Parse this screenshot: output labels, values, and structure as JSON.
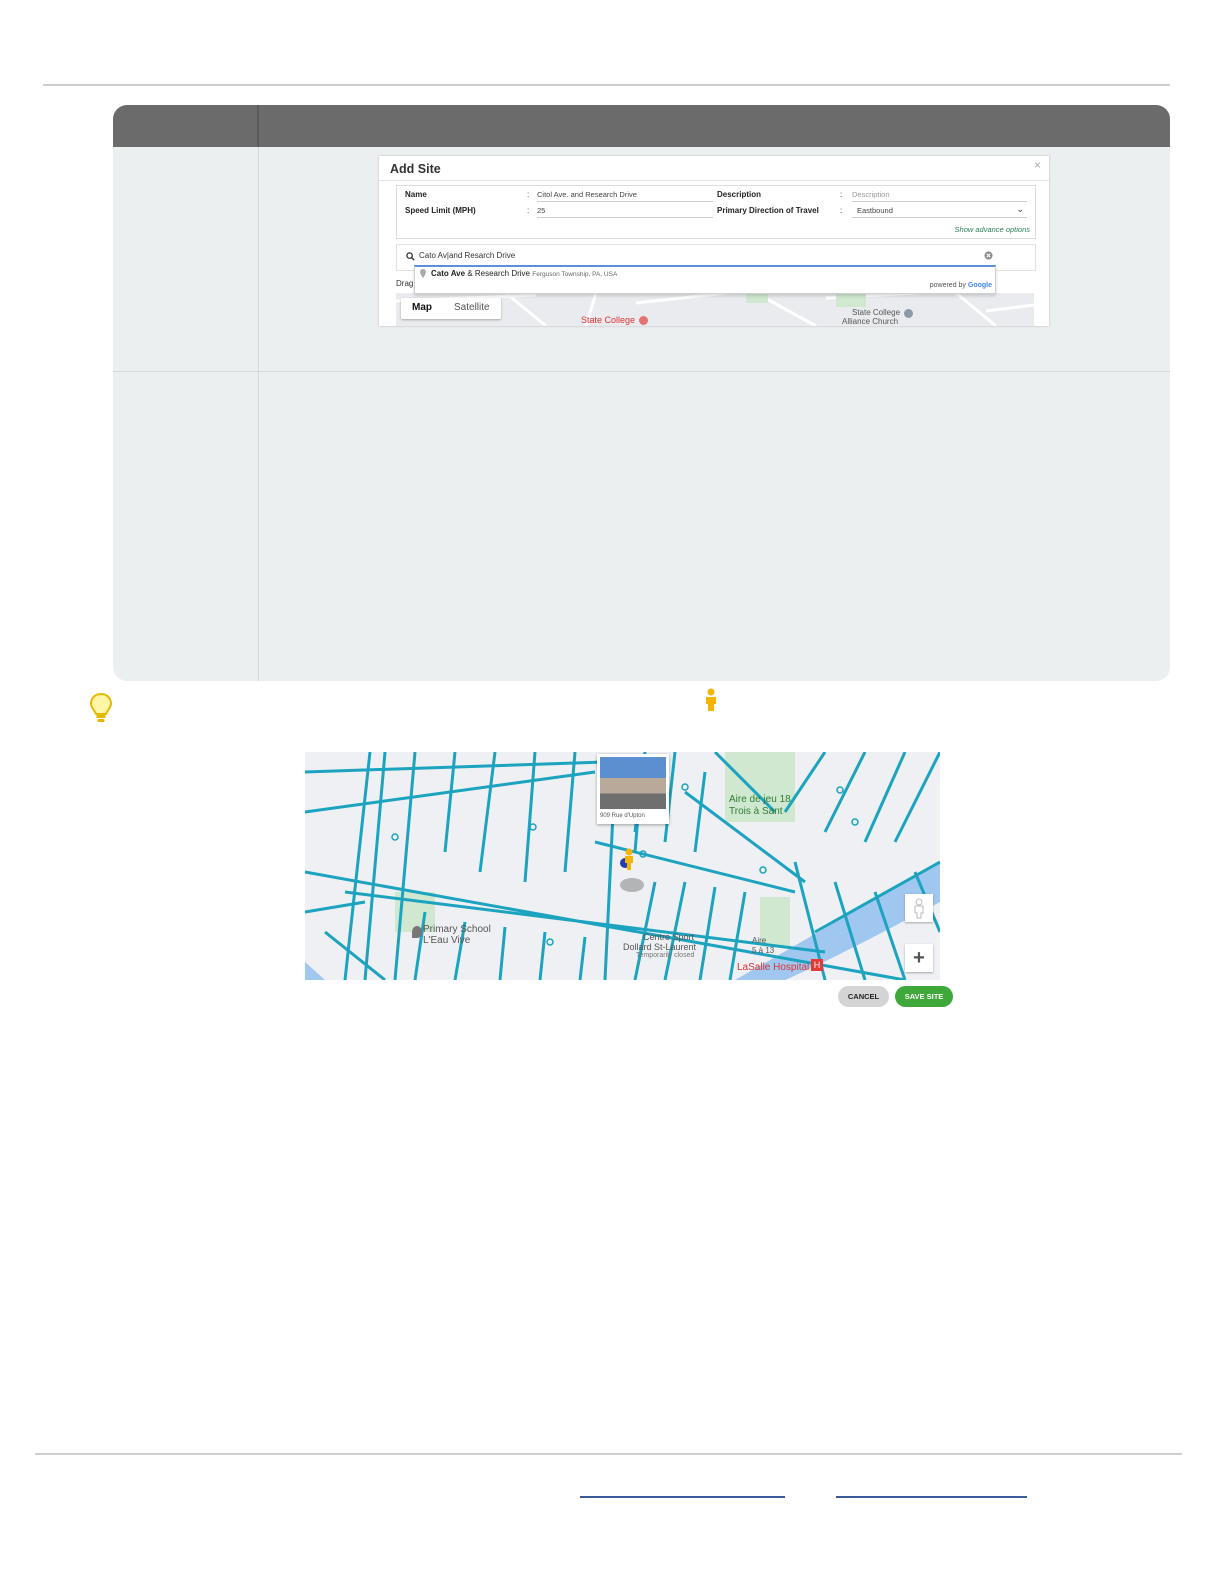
{
  "dialog": {
    "title": "Add Site",
    "close_symbol": "×",
    "fields": {
      "name_label": "Name",
      "name_value": "Citol Ave. and Research Drive",
      "speed_label": "Speed Limit (MPH)",
      "speed_value": "25",
      "description_label": "Description",
      "description_placeholder": "Description",
      "direction_label": "Primary Direction of Travel",
      "direction_value": "Eastbound",
      "colon": ":"
    },
    "advance_options": "Show advance options",
    "search_value": "Cato Av|and Resarch Drive",
    "autocomplete": {
      "main_bold": "Cato Ave",
      "main_rest": " & Research Drive",
      "secondary": "Ferguson Township, PA, USA",
      "powered_prefix": "powered by ",
      "powered_brand": "Google"
    },
    "drag_text": "Drag",
    "map_tabs": [
      "Map",
      "Satellite"
    ],
    "map_labels": [
      "State College",
      "State College",
      "Alliance Church"
    ]
  },
  "bigmap": {
    "streetview_caption": "909 Rue d'Upton",
    "labels": [
      "Aire de jeu 18",
      "Trois à Sant",
      "Primary School",
      "L'Eau Vive",
      "Centre Sport",
      "Dollard St-Laurent",
      "Temporarily closed",
      "LaSalle Hospital",
      "Aire",
      "5 à 13"
    ],
    "zoom_in": "+",
    "cancel": "CANCEL",
    "save": "SAVE SITE"
  },
  "colors": {
    "header_gray": "#6b6b6b",
    "table_bg": "#eceff0",
    "overlay_cyan": "#1ba3bf",
    "save_green": "#3ea83a"
  }
}
